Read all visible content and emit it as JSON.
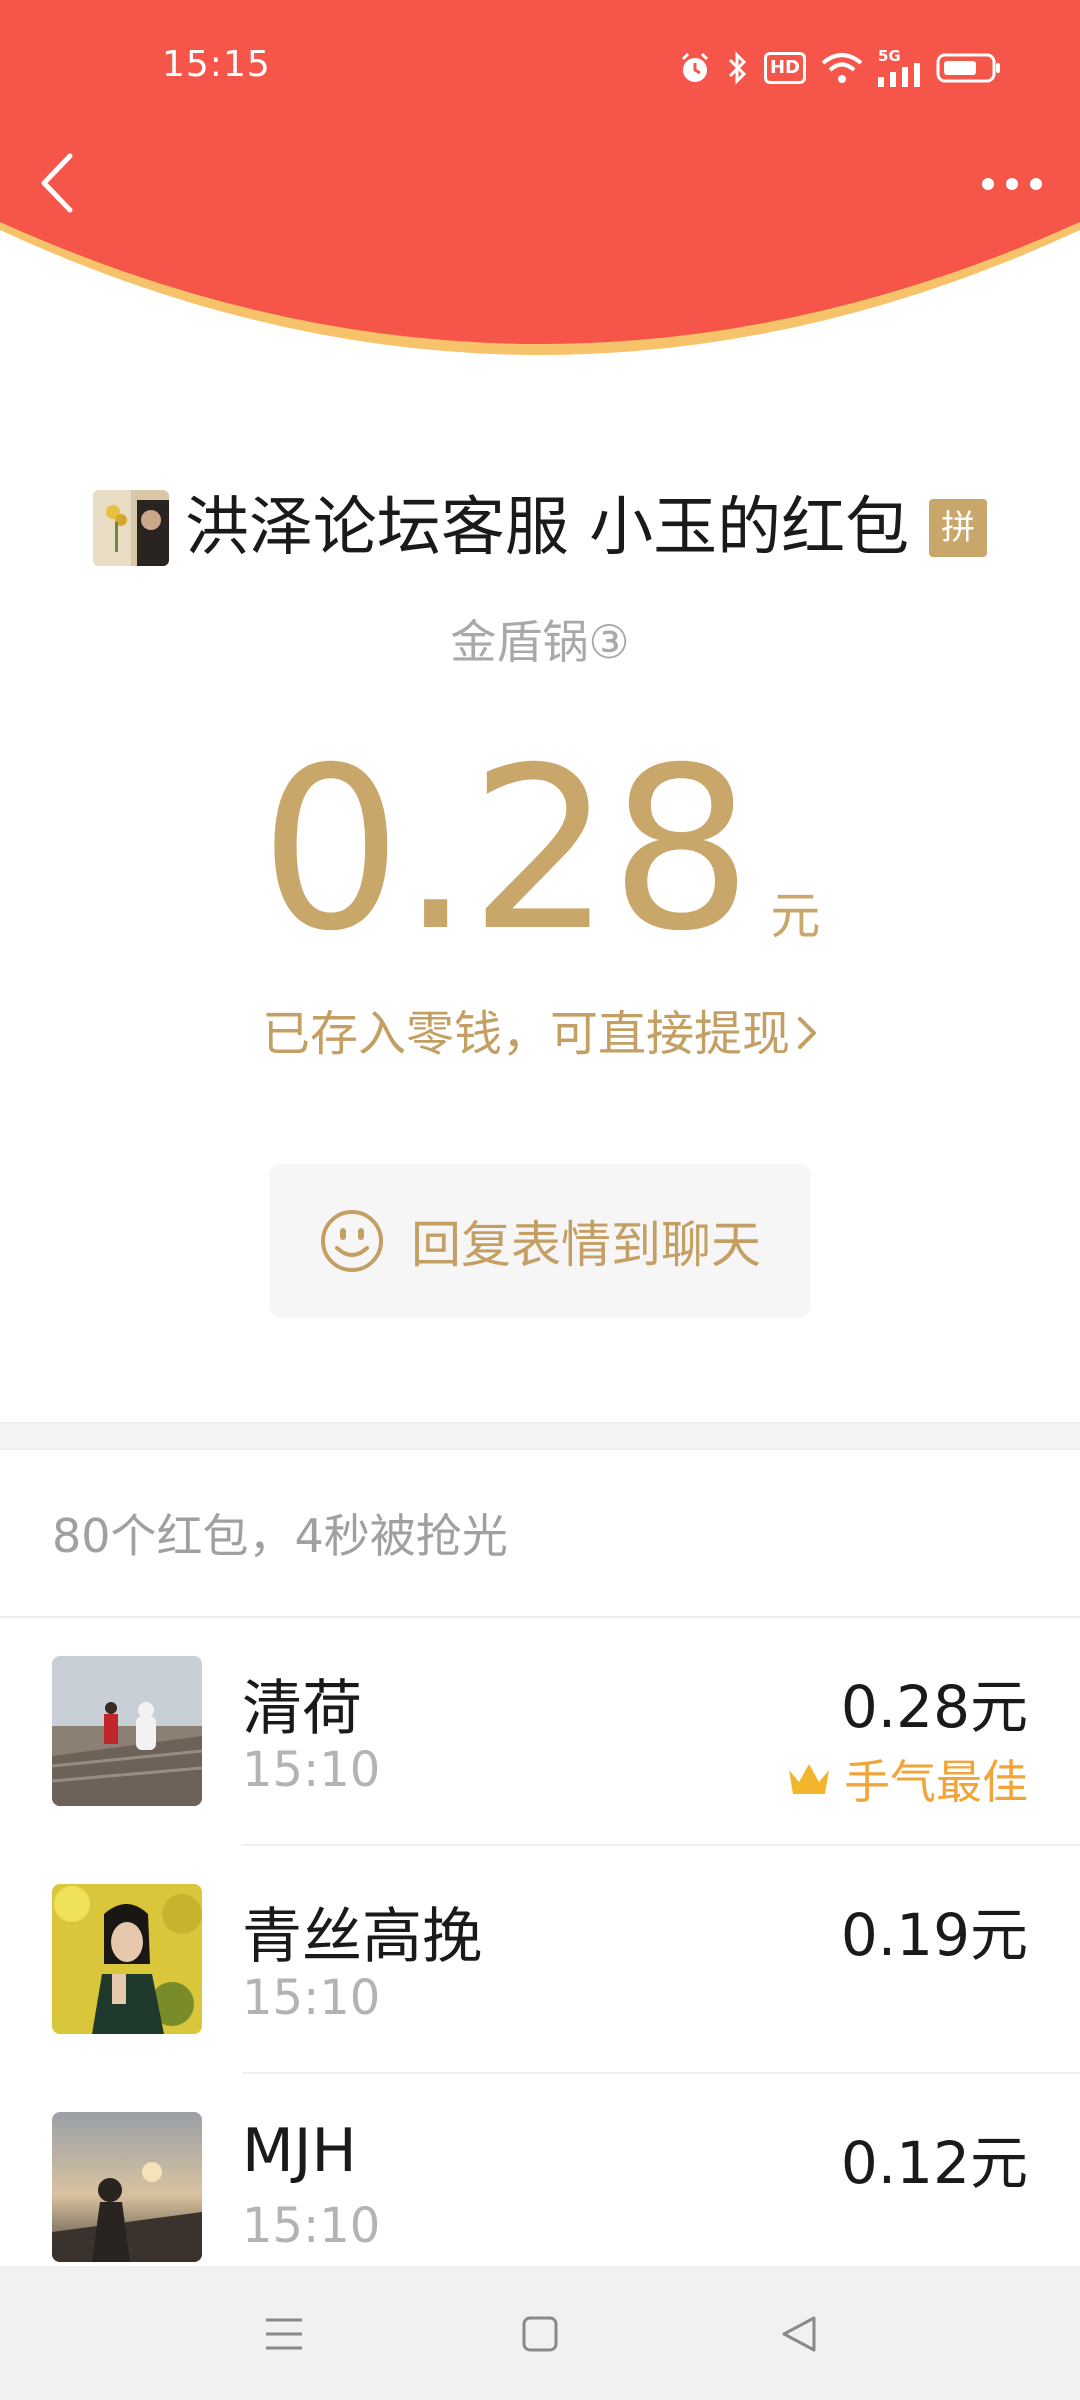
{
  "colors": {
    "header_red": "#f55649",
    "header_rim": "#f6c36a",
    "gold": "#c9a76a",
    "best_orange": "#f2a438"
  },
  "status_bar": {
    "time": "15:15",
    "hd_label": "HD",
    "network_label": "5G",
    "icons": [
      "alarm-icon",
      "bluetooth-icon",
      "hd-icon",
      "wifi-icon",
      "signal-icon",
      "battery-icon"
    ]
  },
  "nav": {
    "back_icon": "chevron-left-icon",
    "more_icon": "more-dots-icon"
  },
  "packet": {
    "sender_title": "洪泽论坛客服 小玉的红包",
    "pin_badge": "拼",
    "subtitle": "金盾锅③",
    "amount": "0.28",
    "unit": "元",
    "deposit_text": "已存入零钱，可直接提现"
  },
  "reply": {
    "label": "回复表情到聊天",
    "icon": "smiley-icon"
  },
  "summary": "80个红包，4秒被抢光",
  "receivers": [
    {
      "name": "清荷",
      "time": "15:10",
      "amount": "0.28元",
      "best_label": "手气最佳"
    },
    {
      "name": "青丝高挽",
      "time": "15:10",
      "amount": "0.19元"
    },
    {
      "name": "MJH",
      "time": "15:10",
      "amount": "0.12元"
    }
  ],
  "system_nav": [
    "menu-icon",
    "home-square-icon",
    "back-triangle-icon"
  ]
}
